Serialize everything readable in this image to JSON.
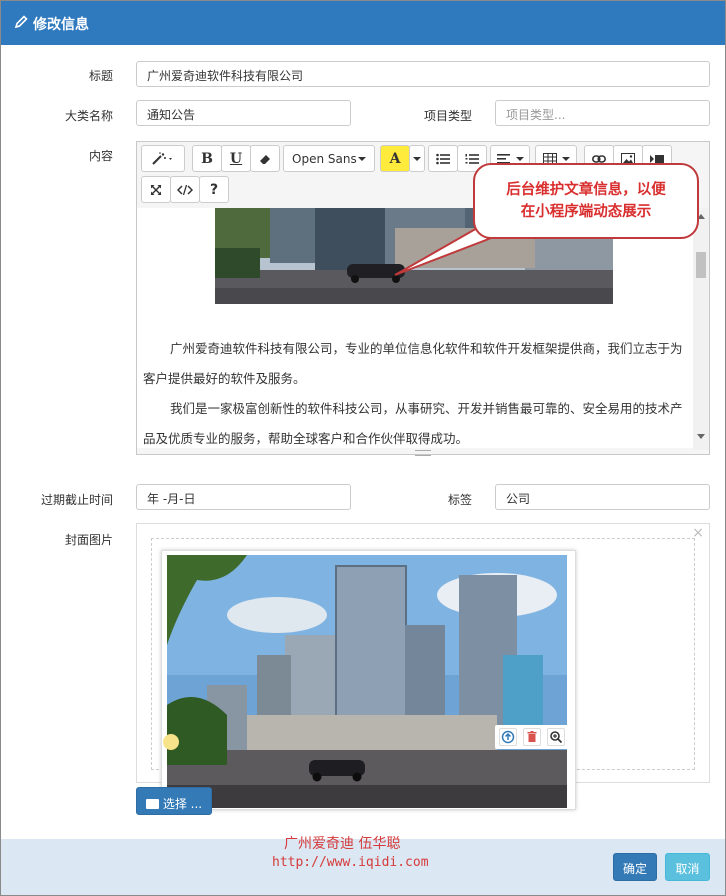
{
  "dialog": {
    "title": "修改信息"
  },
  "form": {
    "title_label": "标题",
    "title_value": "广州爱奇迪软件科技有限公司",
    "category_label": "大类名称",
    "category_value": "通知公告",
    "project_type_label": "项目类型",
    "project_type_placeholder": "项目类型...",
    "content_label": "内容",
    "expiry_label": "过期截止时间",
    "expiry_placeholder": "年 -月-日",
    "tags_label": "标签",
    "tags_value": "公司",
    "cover_label": "封面图片"
  },
  "editor": {
    "font_name": "Open Sans",
    "bold": "B",
    "underline": "U",
    "highlight": "A",
    "help": "?",
    "paragraphs": [
      "广州爱奇迪软件科技有限公司，专业的单位信息化软件和软件开发框架提供商，我们立志于为客户提供最好的软件及服务。",
      "我们是一家极富创新性的软件科技公司，从事研究、开发并销售最可靠的、安全易用的技术产品及优质专业的服务，帮助全球客户和合作伙伴取得成功。"
    ]
  },
  "callout": {
    "line1": "后台维护文章信息，以便",
    "line2": "在小程序端动态展示"
  },
  "upload": {
    "select_label": "选择 ..."
  },
  "footer": {
    "confirm": "确定",
    "cancel": "取消"
  },
  "watermark": {
    "name": "广州爱奇迪 伍华聪",
    "url": "http://www.iqidi.com"
  },
  "colors": {
    "titlebar": "#2f79be",
    "primary": "#337ab7",
    "info": "#5bc0de",
    "footer_bg": "#dbe7f3",
    "callout": "#d92e2e"
  }
}
